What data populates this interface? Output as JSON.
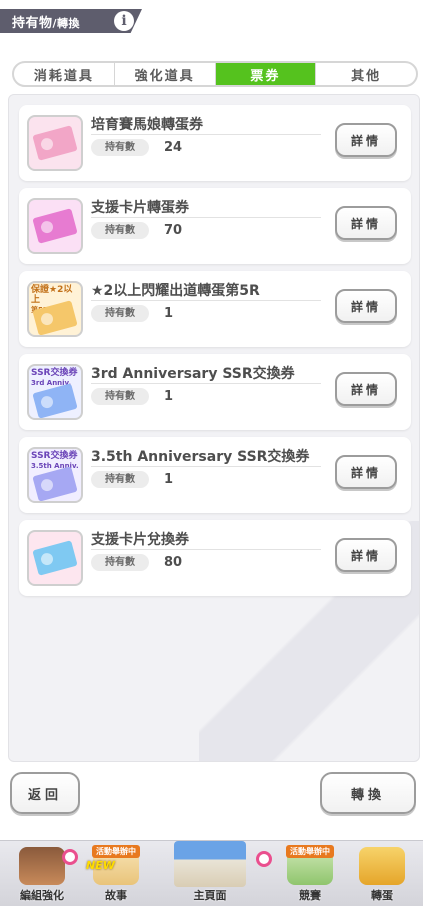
{
  "header": {
    "title": "持有物",
    "subtitle": "/轉換",
    "info_glyph": "i"
  },
  "tabs": [
    {
      "label": "消耗道具",
      "active": false
    },
    {
      "label": "強化道具",
      "active": false
    },
    {
      "label": "票券",
      "active": true
    },
    {
      "label": "其他",
      "active": false
    }
  ],
  "items": [
    {
      "name": "培育賽馬娘轉蛋券",
      "qty_label": "持有數",
      "qty": "24",
      "detail_label": "詳情",
      "ticket_color": "#f2a6c7",
      "thumb_text": "",
      "thumb_small": ""
    },
    {
      "name": "支援卡片轉蛋券",
      "qty_label": "持有數",
      "qty": "70",
      "detail_label": "詳情",
      "ticket_color": "#e77bd1",
      "thumb_text": "",
      "thumb_small": ""
    },
    {
      "name": "★2以上閃耀出道轉蛋第5R",
      "qty_label": "持有數",
      "qty": "1",
      "detail_label": "詳情",
      "ticket_color": "#f5c76a",
      "thumb_text": "保證★2以上",
      "thumb_small": "第5R"
    },
    {
      "name": "3rd Anniversary SSR交換券",
      "qty_label": "持有數",
      "qty": "1",
      "detail_label": "詳情",
      "ticket_color": "#8fb4f5",
      "thumb_text": "SSR交換券",
      "thumb_small": "3rd Anniv."
    },
    {
      "name": "3.5th Anniversary SSR交換券",
      "qty_label": "持有數",
      "qty": "1",
      "detail_label": "詳情",
      "ticket_color": "#a6a8f3",
      "thumb_text": "SSR交換券",
      "thumb_small": "3.5th Anniv."
    },
    {
      "name": "支援卡片兌換券",
      "qty_label": "持有數",
      "qty": "80",
      "detail_label": "詳情",
      "ticket_color": "#7fc9f2",
      "thumb_text": "",
      "thumb_small": ""
    }
  ],
  "buttons": {
    "back": "返回",
    "convert": "轉換"
  },
  "bottom_nav": [
    {
      "label": "編組強化",
      "badge": "",
      "new": ""
    },
    {
      "label": "故事",
      "badge": "活動舉辦中",
      "new": "NEW"
    },
    {
      "label": "主頁面",
      "badge": "",
      "new": ""
    },
    {
      "label": "競賽",
      "badge": "活動舉辦中",
      "new": ""
    },
    {
      "label": "轉蛋",
      "badge": "",
      "new": ""
    }
  ],
  "colors": {
    "active_tab": "#55c21e",
    "header_bg": "#5e5d6d",
    "badge_orange": "#e8791f",
    "heart_pink": "#ea4f8e"
  }
}
